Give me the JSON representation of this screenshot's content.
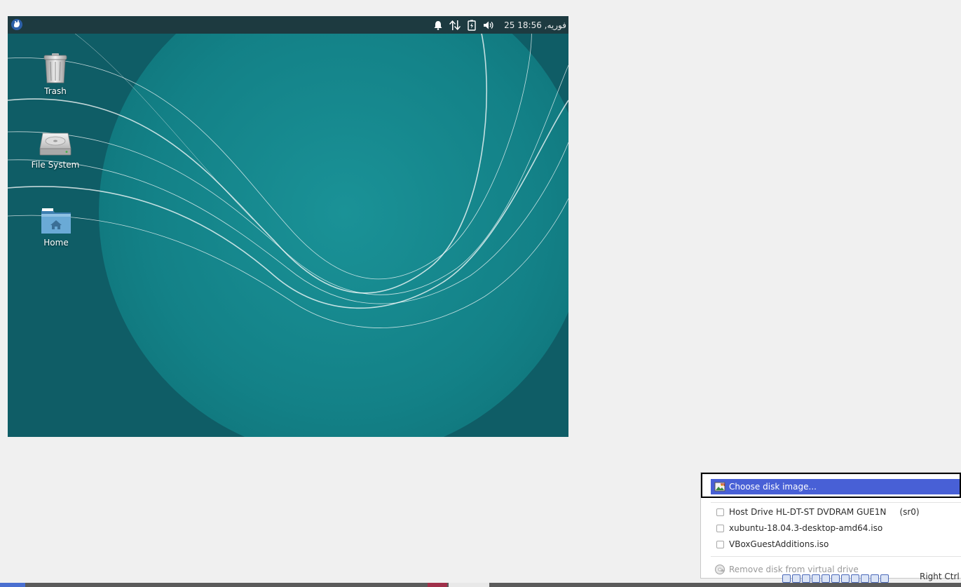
{
  "guest": {
    "topbar": {
      "clock": "25 فوریه, 18:56",
      "icons": [
        "whisker-menu-icon",
        "bell-icon",
        "network-arrows-icon",
        "battery-icon",
        "volume-icon"
      ]
    },
    "desktop_icons": [
      {
        "label": "Trash",
        "icon": "trash-icon"
      },
      {
        "label": "File System",
        "icon": "hard-drive-icon"
      },
      {
        "label": "Home",
        "icon": "home-folder-icon"
      }
    ]
  },
  "menu": {
    "choose": "Choose disk image...",
    "items": [
      {
        "label": "Host Drive HL-DT-ST DVDRAM GUE1N     (sr0)"
      },
      {
        "label": "xubuntu-18.04.3-desktop-amd64.iso"
      },
      {
        "label": "VBoxGuestAdditions.iso"
      }
    ],
    "remove": "Remove disk from virtual drive"
  },
  "statusbar": {
    "host_key": "Right Ctrl"
  },
  "colors": {
    "menu_highlight": "#4860d6",
    "topbar": "#1d3a40",
    "wallpaper_teal": "#15888c"
  }
}
